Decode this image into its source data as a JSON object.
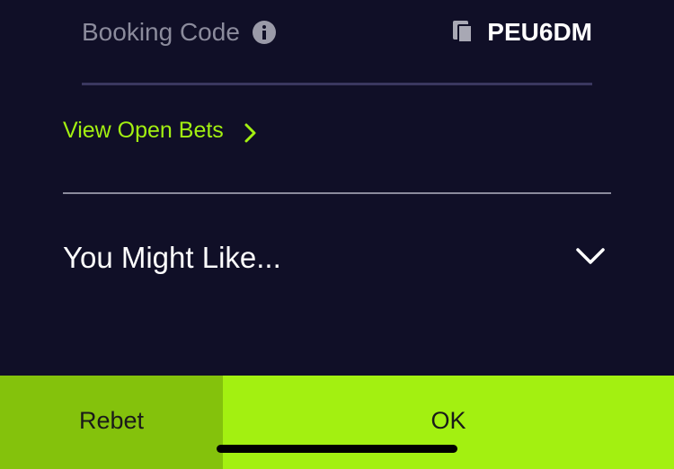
{
  "booking": {
    "label": "Booking Code",
    "info_icon": "info-icon",
    "copy_icon": "copy-icon",
    "code": "PEU6DM"
  },
  "open_bets": {
    "label": "View Open Bets",
    "icon": "chevron-right-icon"
  },
  "recommendations": {
    "title": "You Might Like...",
    "icon": "chevron-down-icon"
  },
  "actions": {
    "rebet_label": "Rebet",
    "ok_label": "OK"
  },
  "colors": {
    "background": "#100f27",
    "accent": "#a3f011",
    "accent_dark": "#84c20c"
  }
}
